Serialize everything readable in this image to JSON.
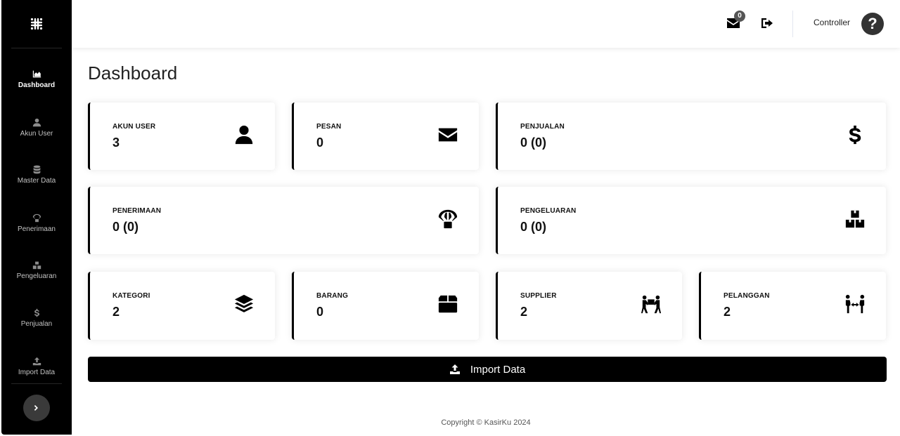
{
  "sidebar": {
    "brand_icon": "slack-logo-icon",
    "items": [
      {
        "label": "Dashboard",
        "icon": "chart-area-icon",
        "active": true
      },
      {
        "label": "Akun User",
        "icon": "user-icon",
        "active": false
      },
      {
        "label": "Master Data",
        "icon": "database-icon",
        "active": false
      },
      {
        "label": "Penerimaan",
        "icon": "parachute-box-icon",
        "active": false
      },
      {
        "label": "Pengeluaran",
        "icon": "boxes-icon",
        "active": false
      },
      {
        "label": "Penjualan",
        "icon": "dollar-sign-icon",
        "active": false
      },
      {
        "label": "Import Data",
        "icon": "upload-icon",
        "active": false
      }
    ],
    "toggle_icon": "chevron-right-icon"
  },
  "topbar": {
    "message_count": "0",
    "user_name": "Controller",
    "avatar_glyph": "?"
  },
  "page": {
    "title": "Dashboard"
  },
  "cards": [
    {
      "label": "AKUN USER",
      "value": "3",
      "icon": "user-icon"
    },
    {
      "label": "PESAN",
      "value": "0",
      "icon": "envelope-icon"
    },
    {
      "label": "PENJUALAN",
      "value": "0 (0)",
      "icon": "dollar-sign-icon"
    },
    {
      "label": "PENERIMAAN",
      "value": "0 (0)",
      "icon": "parachute-box-icon"
    },
    {
      "label": "PENGELUARAN",
      "value": "0 (0)",
      "icon": "boxes-icon"
    },
    {
      "label": "KATEGORI",
      "value": "2",
      "icon": "layer-group-icon"
    },
    {
      "label": "BARANG",
      "value": "0",
      "icon": "box-icon"
    },
    {
      "label": "SUPPLIER",
      "value": "2",
      "icon": "people-carry-icon"
    },
    {
      "label": "PELANGGAN",
      "value": "2",
      "icon": "people-arrows-icon"
    }
  ],
  "import_button": {
    "label": "Import Data",
    "icon": "upload-icon"
  },
  "footer": {
    "text": "Copyright © KasirKu 2024"
  },
  "colors": {
    "sidebar_bg": "#000000",
    "accent": "#000000",
    "page_bg": "#ffffff"
  }
}
